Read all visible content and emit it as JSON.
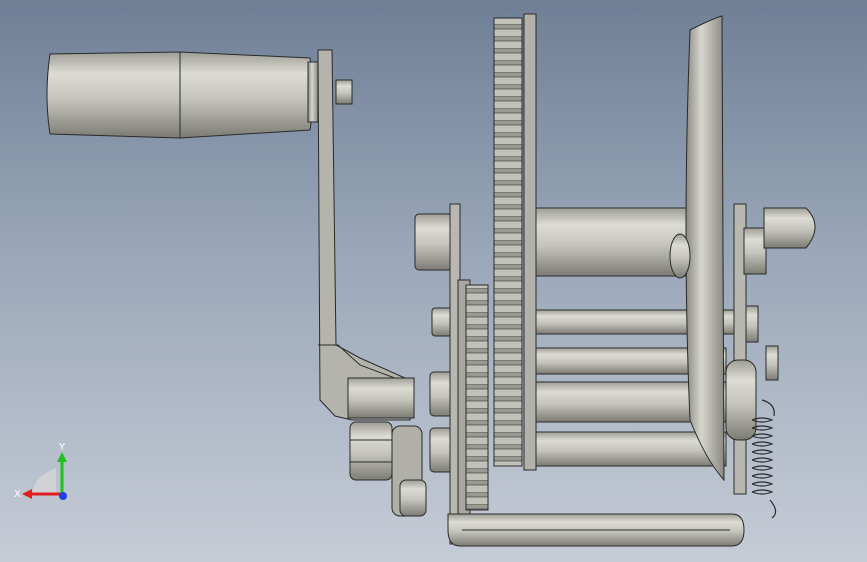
{
  "viewport": {
    "background_top": "#6f7f96",
    "background_bottom": "#c6ccd6"
  },
  "model": {
    "part_color": "#c8c8bf",
    "edge_color": "#2a2a2a",
    "parts": [
      "crank-handle",
      "crank-arm",
      "drive-gear",
      "cable-drum",
      "drum-flange",
      "frame-plate",
      "base-bar",
      "pawl-spring",
      "hex-nut"
    ]
  },
  "triad": {
    "x_label": "X",
    "y_label": "Y",
    "x_color": "#e02020",
    "y_color": "#20c020",
    "z_color": "#2040e0"
  }
}
